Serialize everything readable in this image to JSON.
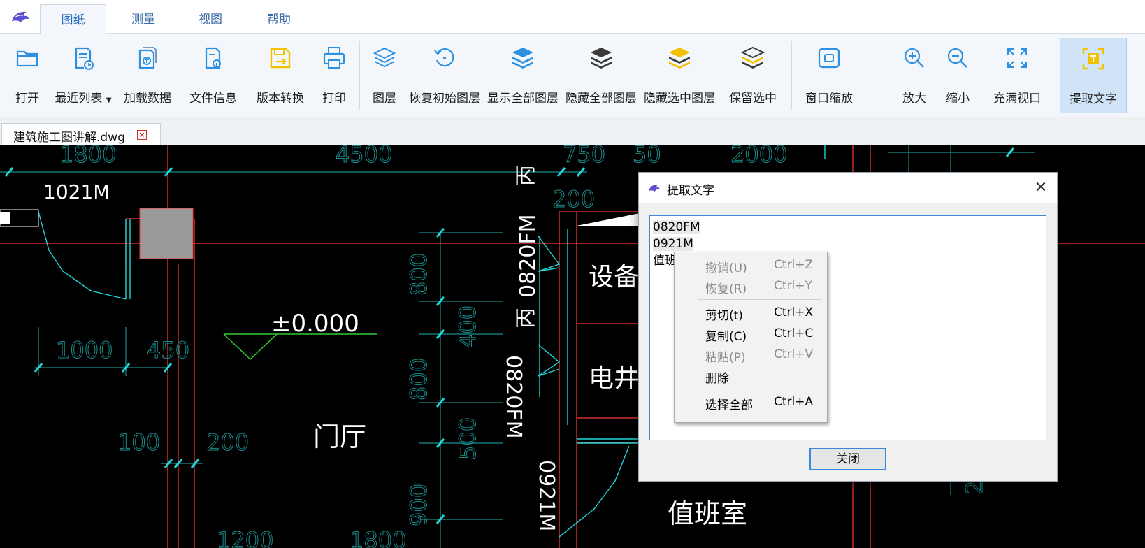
{
  "ribbon_tabs": [
    "图纸",
    "测量",
    "视图",
    "帮助"
  ],
  "active_tab": "图纸",
  "toolbar": {
    "open": "打开",
    "recent_list": "最近列表",
    "load_data": "加载数据",
    "file_info": "文件信息",
    "version_convert": "版本转换",
    "print": "打印",
    "layers": "图层",
    "restore_layers": "恢复初始图层",
    "show_all_layers": "显示全部图层",
    "hide_all_layers": "隐藏全部图层",
    "hide_selected_layers": "隐藏选中图层",
    "keep_selected": "保留选中",
    "window_zoom": "窗口缩放",
    "zoom_in": "放大",
    "zoom_out": "缩小",
    "fit_view": "充满视口",
    "extract_text": "提取文字"
  },
  "document_tab": {
    "name": "建筑施工图讲解.dwg"
  },
  "cad": {
    "dims": [
      "1800",
      "4500",
      "750",
      "50",
      "2000",
      "200",
      "1021M",
      "800",
      "400",
      "800",
      "500",
      "900",
      "1000",
      "450",
      "100",
      "200",
      "1200",
      "1800",
      "2"
    ],
    "level": "±0.000",
    "rooms": [
      "设备",
      "电井",
      "门厅",
      "值班室"
    ],
    "tags": [
      "0820FM",
      "丙",
      "丙",
      "0820FM",
      "0921M"
    ]
  },
  "dialog": {
    "title": "提取文字",
    "lines": [
      "0820FM",
      "0921M",
      "值班"
    ],
    "close_button": "关闭"
  },
  "context_menu": {
    "items": [
      {
        "label": "撤销(U)",
        "shortcut": "Ctrl+Z",
        "enabled": false
      },
      {
        "label": "恢复(R)",
        "shortcut": "Ctrl+Y",
        "enabled": false
      },
      {
        "label": "剪切(t)",
        "shortcut": "Ctrl+X",
        "enabled": true
      },
      {
        "label": "复制(C)",
        "shortcut": "Ctrl+C",
        "enabled": true
      },
      {
        "label": "粘贴(P)",
        "shortcut": "Ctrl+V",
        "enabled": false
      },
      {
        "label": "删除",
        "shortcut": "",
        "enabled": true
      },
      {
        "label": "选择全部",
        "shortcut": "Ctrl+A",
        "enabled": true
      }
    ]
  },
  "colors": {
    "accent": "#2e90e0",
    "layer_yellow": "#f2c200",
    "canvas_bg": "#000000",
    "cad_cyan": "#1fd7d7",
    "cad_red": "#ff3b3b",
    "cad_teal": "#1a8c8c"
  }
}
